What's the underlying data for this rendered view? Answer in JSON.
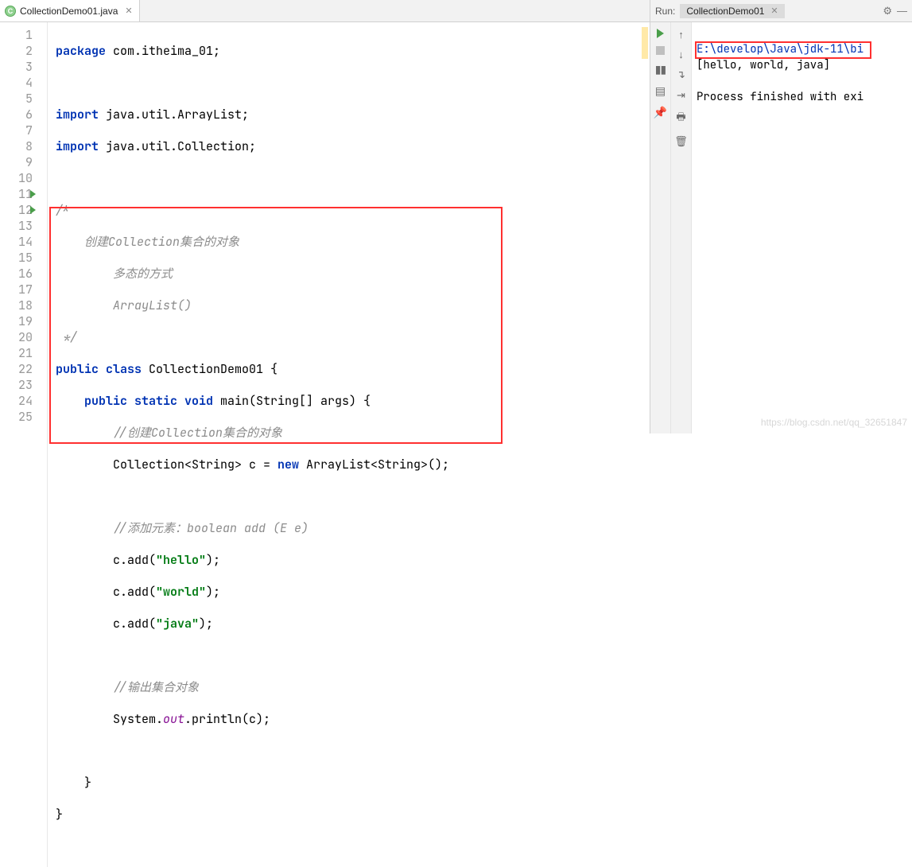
{
  "tab": {
    "filename": "CollectionDemo01.java"
  },
  "gutter": {
    "lines": 25
  },
  "code": {
    "l1": {
      "pkg_kw": "package",
      "pkg": " com.itheima_01;"
    },
    "l3": {
      "imp_kw": "import",
      "imp": " java.util.ArrayList;"
    },
    "l4": {
      "imp_kw": "import",
      "imp": " java.util.Collection;"
    },
    "l6": "/*",
    "l7": "    创建Collection集合的对象",
    "l8": "        多态的方式",
    "l9": "        ArrayList()",
    "l10": " */",
    "l11": {
      "a": "public class",
      "b": " CollectionDemo01 {"
    },
    "l12": {
      "a": "public static void",
      "b": " main(String[] args) {"
    },
    "l13": "//创建Collection集合的对象",
    "l14": {
      "a": "Collection<String> c = ",
      "b": "new",
      "c": " ArrayList<String>();"
    },
    "l16": "//添加元素：boolean add (E e)",
    "l17": {
      "a": "c.add(",
      "s": "\"hello\"",
      "b": ");"
    },
    "l18": {
      "a": "c.add(",
      "s": "\"world\"",
      "b": ");"
    },
    "l19": {
      "a": "c.add(",
      "s": "\"java\"",
      "b": ");"
    },
    "l21": "//输出集合对象",
    "l22": {
      "a": "System.",
      "f": "out",
      "b": ".println(c);"
    },
    "l24": "    }",
    "l25": "}"
  },
  "run": {
    "label": "Run:",
    "config": "CollectionDemo01",
    "out_path": "E:\\develop\\Java\\jdk-11\\bi",
    "out_line": "[hello, world, java]",
    "out_exit": "Process finished with exi"
  },
  "watermark": "https://blog.csdn.net/qq_32651847"
}
